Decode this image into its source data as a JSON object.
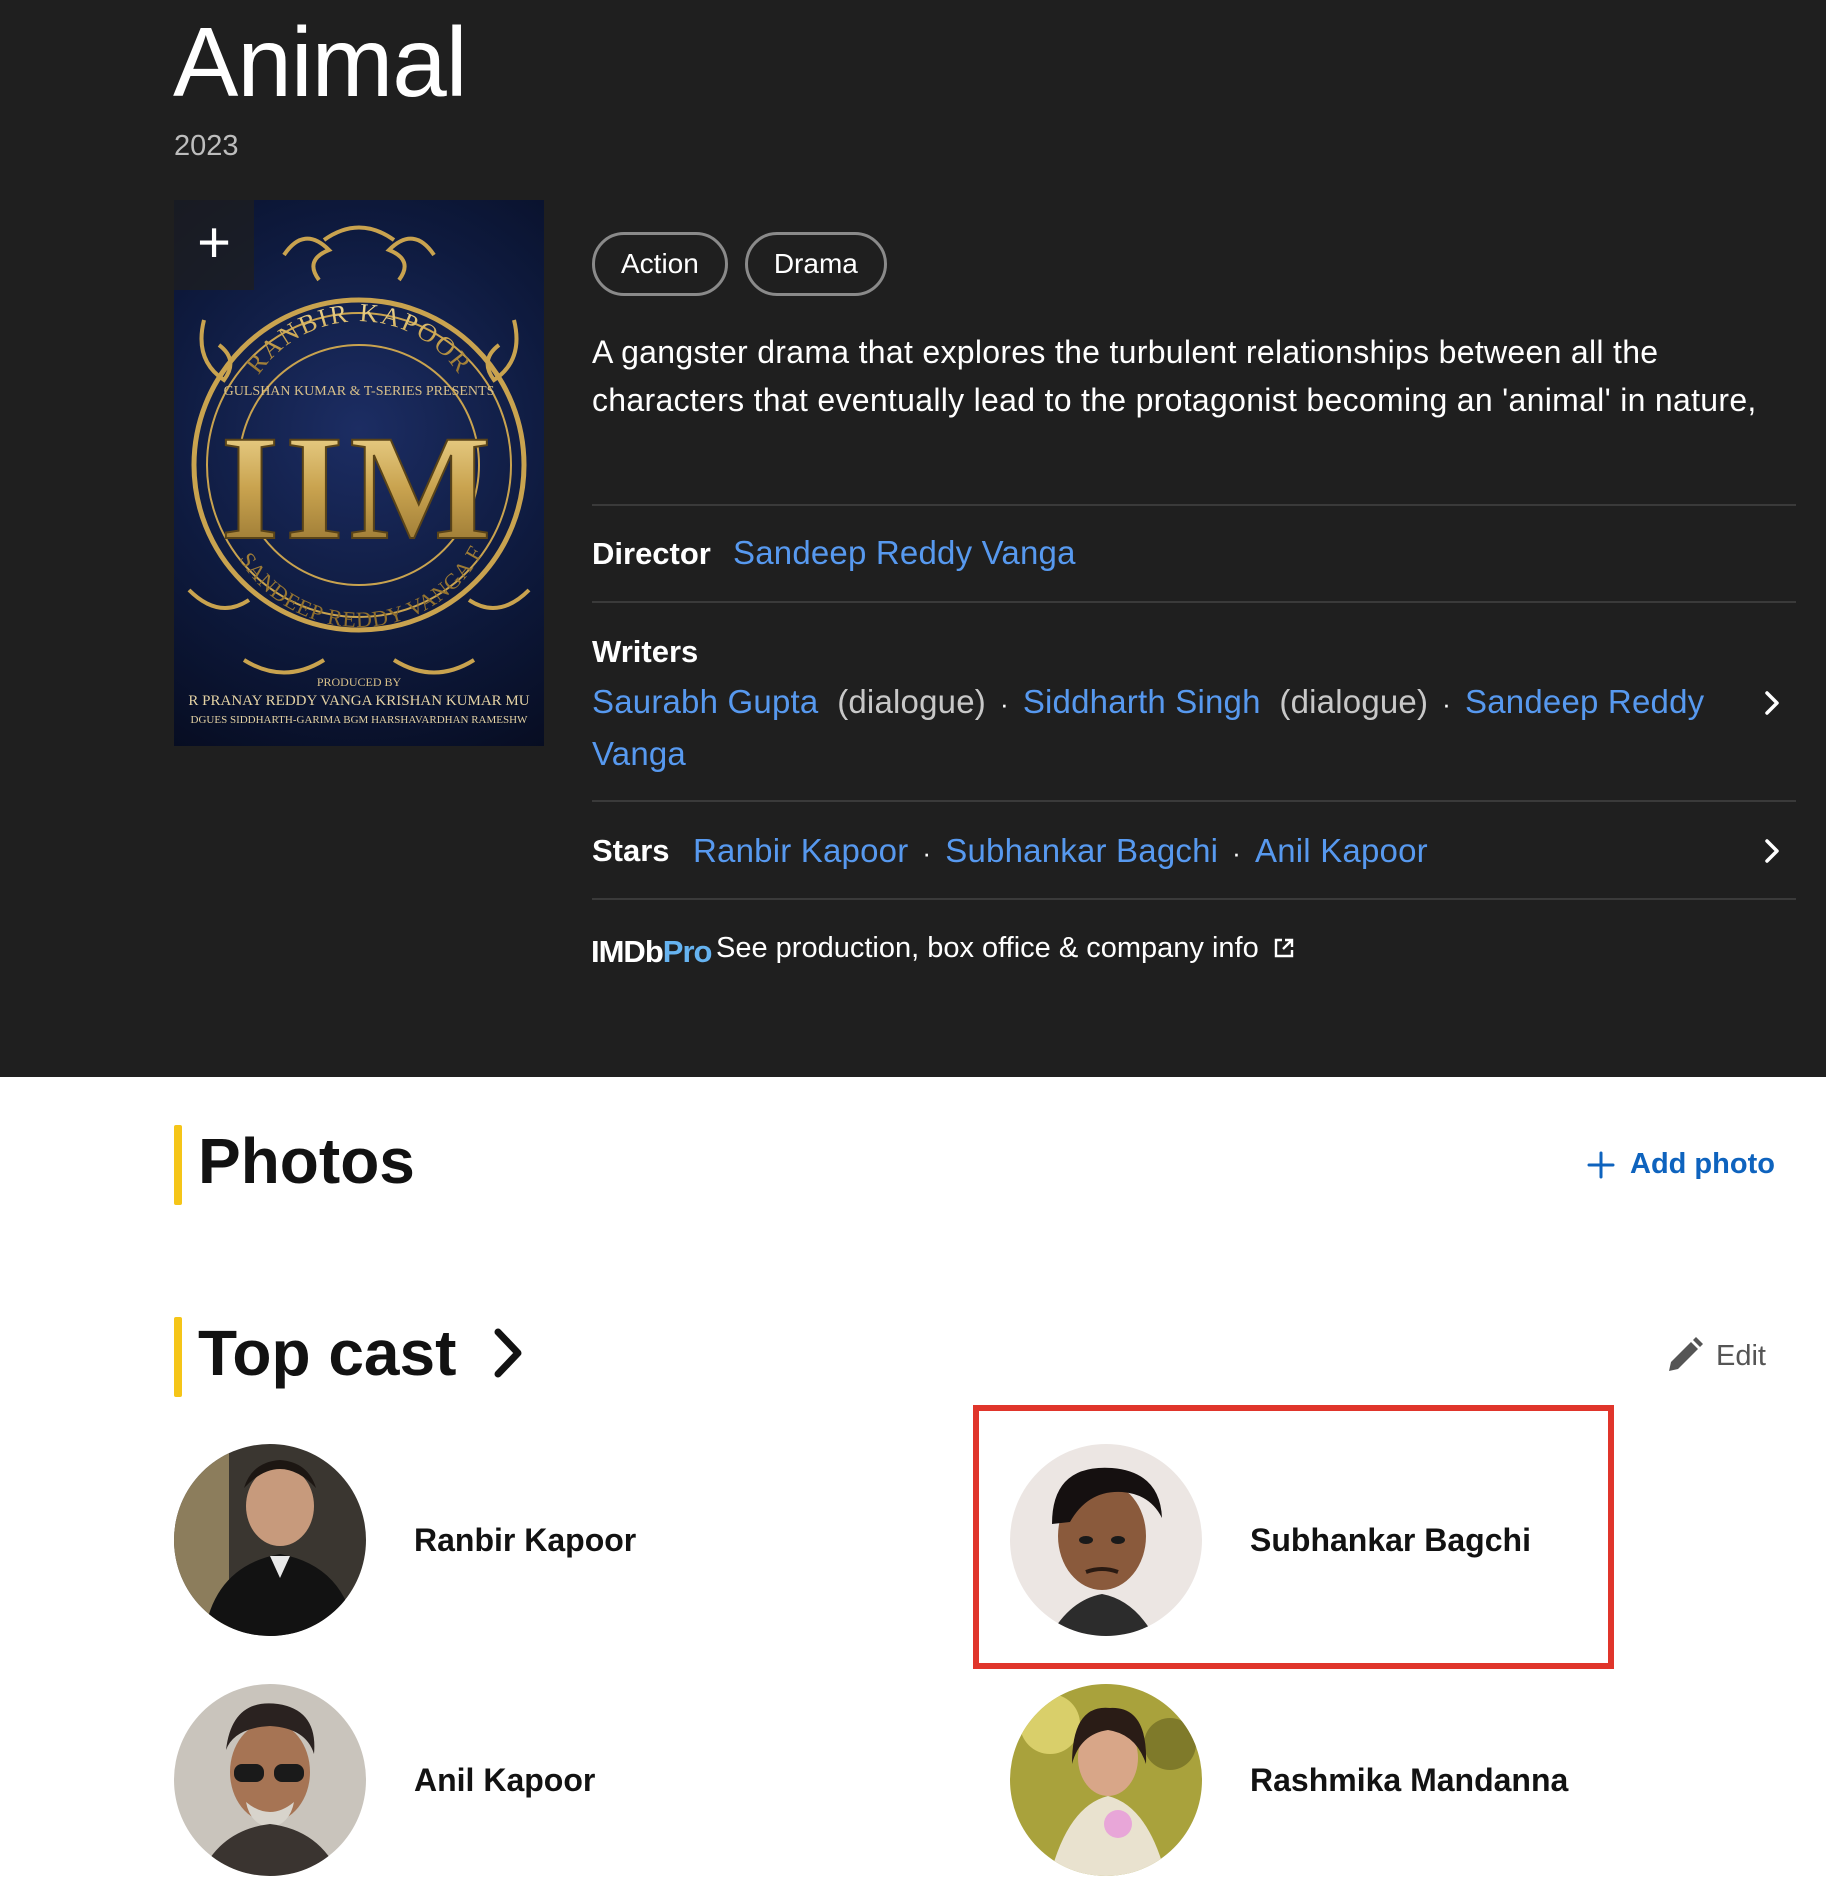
{
  "title": "Animal",
  "year": "2023",
  "poster": {
    "add_icon": "plus-icon",
    "text_top": "RANBIR KAPOOR",
    "text_presents": "GULSHAN KUMAR & T-SERIES PRESENTS",
    "text_big": "IIM",
    "text_bottom": "THE SANDEEP REDDY VANGA FILM",
    "text_produced_by": "PRODUCED BY",
    "text_producers_1": "R  PRANAY REDDY VANGA   KRISHAN KUMAR  MU",
    "text_producers_2": "DGUES SIDDHARTH-GARIMA    BGM HARSHAVARDHAN RAMESHW"
  },
  "genres": [
    "Action",
    "Drama"
  ],
  "plot": "A gangster drama that explores the turbulent relationships between all the characters that eventually lead to the protagonist becoming an 'animal' in nature,",
  "director": {
    "label": "Director",
    "name": "Sandeep Reddy Vanga"
  },
  "writers": {
    "label": "Writers",
    "items": [
      {
        "name": "Saurabh Gupta",
        "note": "(dialogue)"
      },
      {
        "name": "Siddharth Singh",
        "note": "(dialogue)"
      },
      {
        "name_line1": "Sandeep Reddy",
        "name_line2": "Vanga"
      }
    ]
  },
  "stars": {
    "label": "Stars",
    "items": [
      "Ranbir Kapoor",
      "Subhankar Bagchi",
      "Anil Kapoor"
    ]
  },
  "imdbpro": {
    "logo_a": "IMDb",
    "logo_b": "Pro",
    "text": "See production, box office & company info",
    "icon": "external-link-icon"
  },
  "photos": {
    "title": "Photos",
    "add_label": "Add photo"
  },
  "top_cast": {
    "title": "Top cast",
    "edit_label": "Edit",
    "members": [
      "Ranbir Kapoor",
      "Subhankar Bagchi",
      "Anil Kapoor",
      "Rashmika Mandanna"
    ]
  },
  "colors": {
    "accent": "#f5c518",
    "link": "#5799ef",
    "highlight": "#e0352b",
    "hero_bg": "#1f1f1f"
  }
}
